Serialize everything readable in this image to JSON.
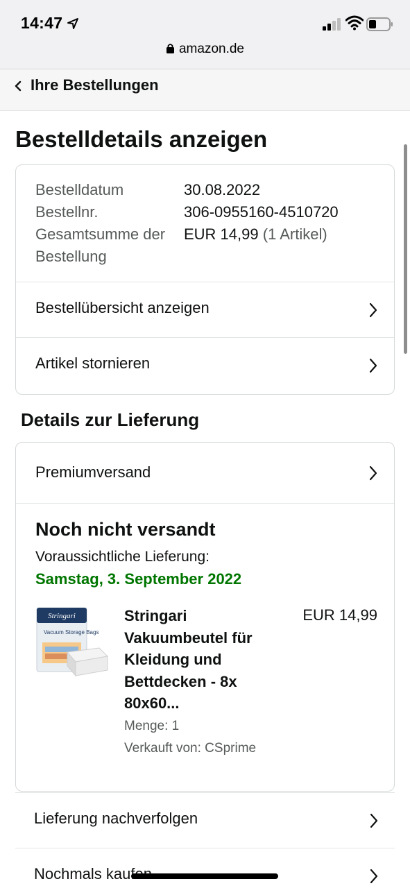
{
  "status_bar": {
    "time": "14:47"
  },
  "browser": {
    "url": "amazon.de"
  },
  "nav": {
    "back_label": "Ihre Bestellungen"
  },
  "page": {
    "title": "Bestelldetails anzeigen"
  },
  "order_info": {
    "rows": [
      {
        "label": "Bestelldatum",
        "value": "30.08.2022",
        "extra": ""
      },
      {
        "label": "Bestellnr.",
        "value": "306-0955160-4510720",
        "extra": ""
      },
      {
        "label": "Gesamtsumme der Bestellung",
        "value": "EUR 14,99",
        "extra": "(1 Artikel)"
      }
    ],
    "links": [
      {
        "label": "Bestellübersicht anzeigen"
      },
      {
        "label": "Artikel stornieren"
      }
    ]
  },
  "delivery": {
    "section_title": "Details zur Lieferung",
    "shipping_method": "Premiumversand",
    "status": "Noch nicht versandt",
    "eta_label": "Voraussichtliche Lieferung:",
    "eta_date": "Samstag, 3. September 2022",
    "eta_color": "#007600",
    "item": {
      "title": "Stringari Vakuumbeutel für Kleidung und Bettdecken - 8x 80x60...",
      "price": "EUR 14,99",
      "quantity": "Menge: 1",
      "seller": "Verkauft von: CSprime",
      "image_brand": "Stringari",
      "image_caption": "Vacuum Storage Bags"
    }
  },
  "actions": [
    {
      "label": "Lieferung nachverfolgen"
    },
    {
      "label": "Nochmals kaufen"
    }
  ]
}
